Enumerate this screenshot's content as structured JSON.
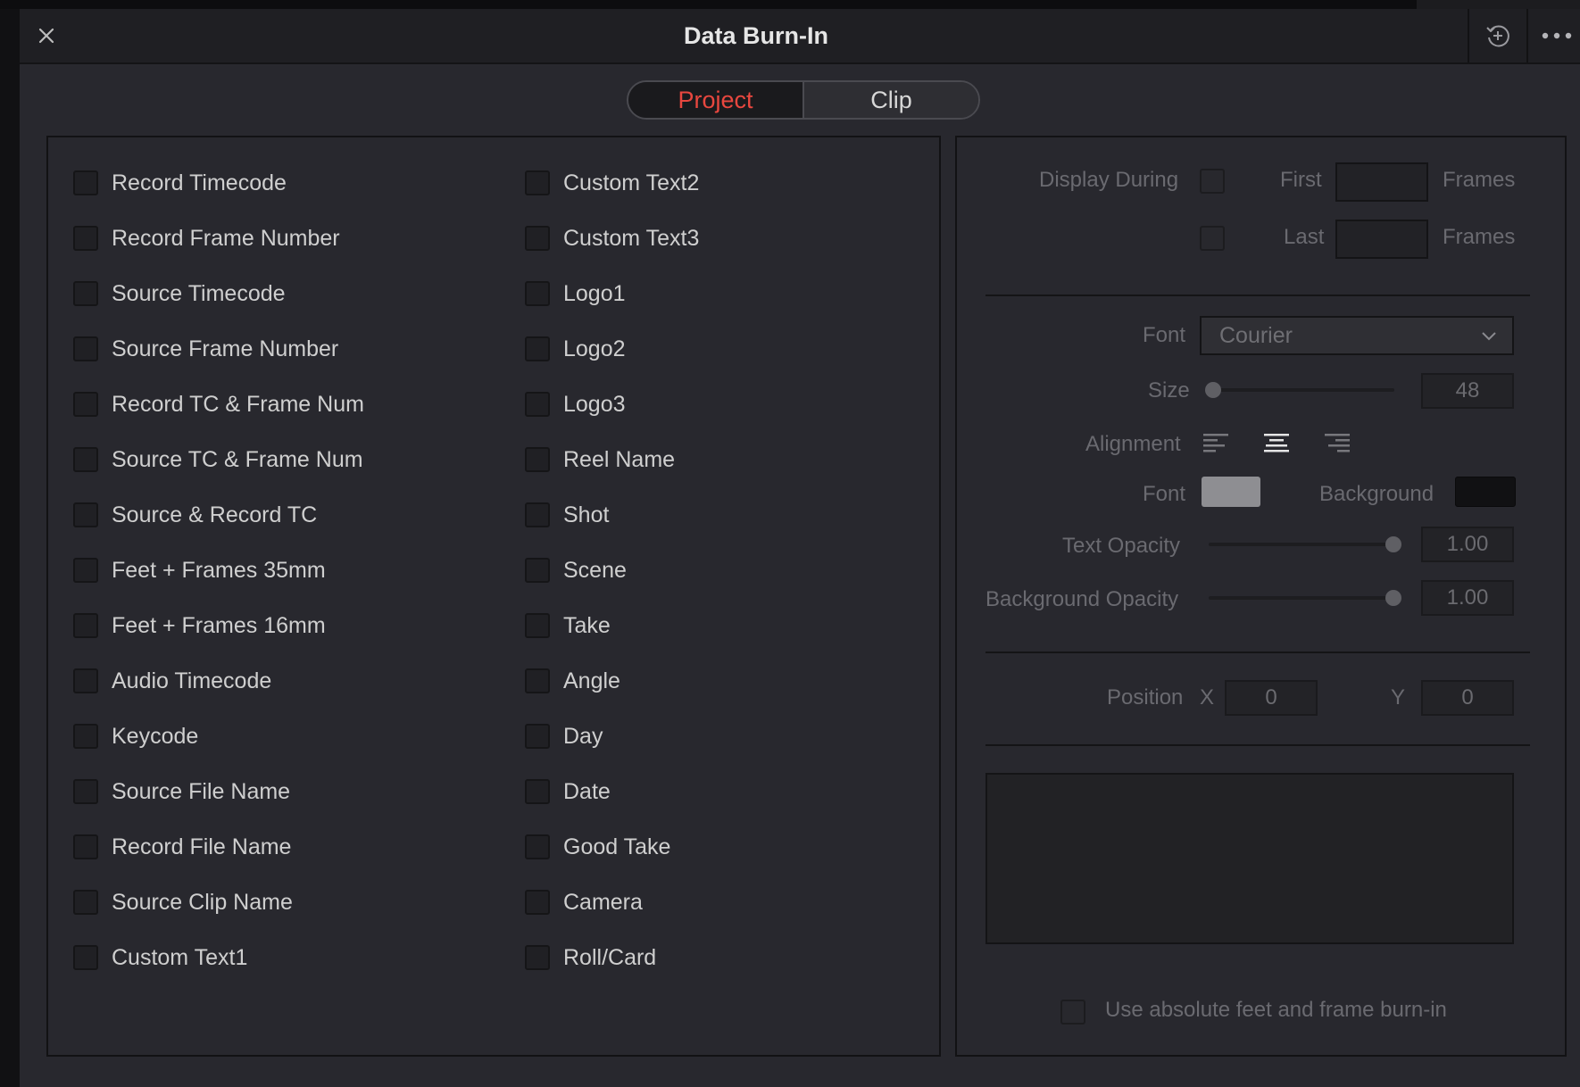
{
  "window": {
    "title": "Data Burn-In"
  },
  "tabs": [
    {
      "label": "Project",
      "active": true
    },
    {
      "label": "Clip",
      "active": false
    }
  ],
  "left_column_options": [
    "Record Timecode",
    "Record Frame Number",
    "Source Timecode",
    "Source Frame Number",
    "Record TC & Frame Num",
    "Source TC & Frame Num",
    "Source & Record TC",
    "Feet + Frames 35mm",
    "Feet + Frames 16mm",
    "Audio Timecode",
    "Keycode",
    "Source File Name",
    "Record File Name",
    "Source Clip Name",
    "Custom Text1"
  ],
  "right_column_options": [
    "Custom Text2",
    "Custom Text3",
    "Logo1",
    "Logo2",
    "Logo3",
    "Reel Name",
    "Shot",
    "Scene",
    "Take",
    "Angle",
    "Day",
    "Date",
    "Good Take",
    "Camera",
    "Roll/Card"
  ],
  "settings": {
    "display_during_label": "Display During",
    "first_label": "First",
    "last_label": "Last",
    "frames_label": "Frames",
    "first_frames_value": "",
    "last_frames_value": "",
    "font_label": "Font",
    "font_value": "Courier",
    "size_label": "Size",
    "size_value": "48",
    "alignment_label": "Alignment",
    "alignment_selected": "center",
    "font_color_label": "Font",
    "background_color_label": "Background",
    "font_color": "#8e8e92",
    "background_color": "#111113",
    "text_opacity_label": "Text Opacity",
    "text_opacity_value": "1.00",
    "background_opacity_label": "Background Opacity",
    "background_opacity_value": "1.00",
    "position_label": "Position",
    "x_label": "X",
    "x_value": "0",
    "y_label": "Y",
    "y_value": "0",
    "absolute_feet_label": "Use absolute feet and frame burn-in"
  },
  "colors": {
    "accent": "#e8473f",
    "panel_bg": "#28282e",
    "titlebar_bg": "#1f1f23"
  }
}
